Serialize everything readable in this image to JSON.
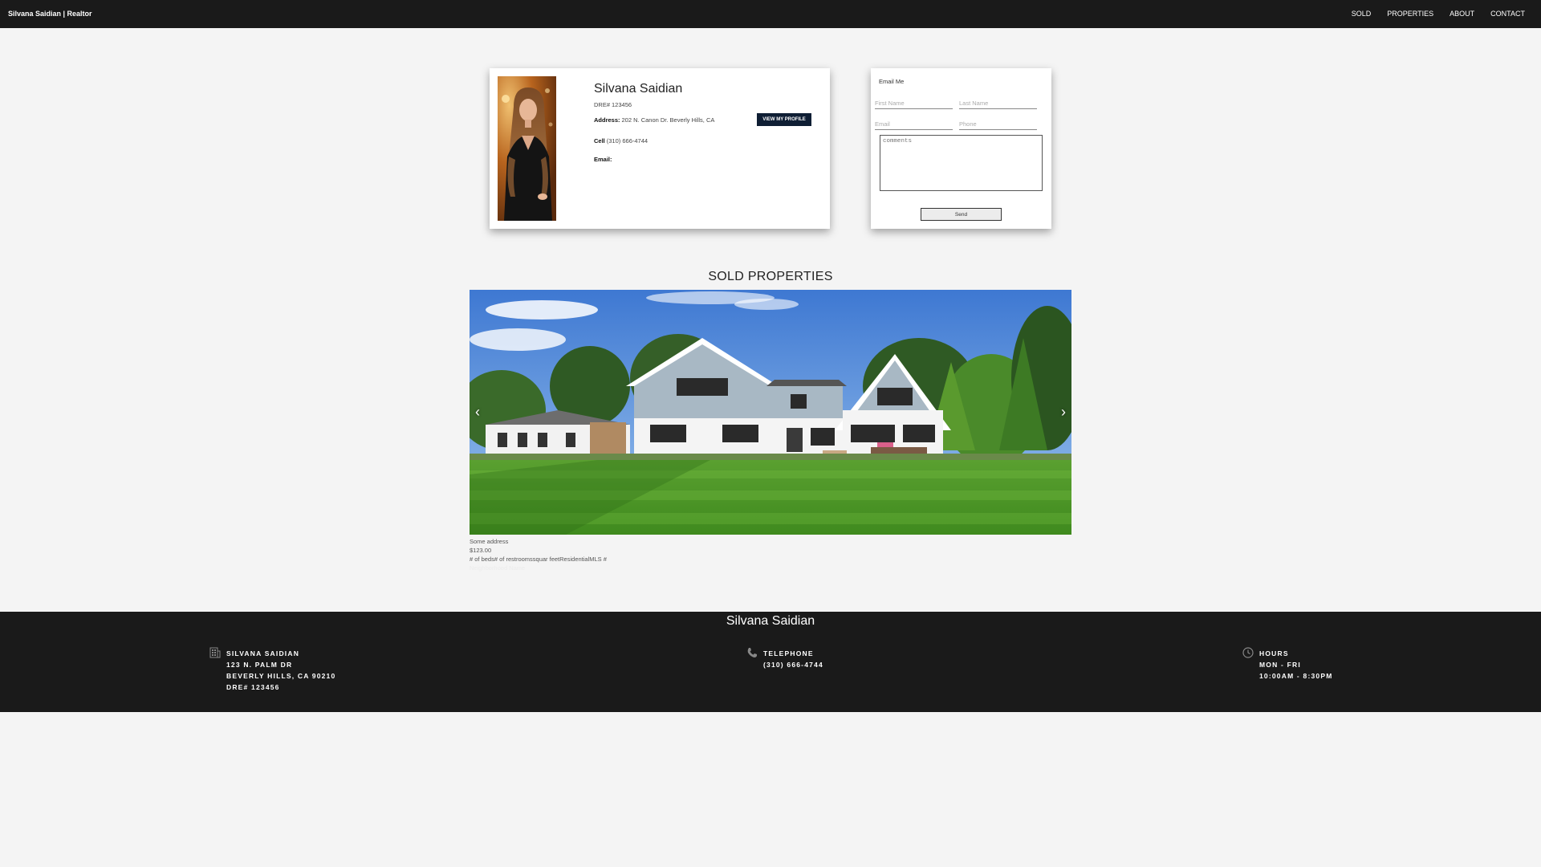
{
  "nav": {
    "brand": "Silvana Saidian | Realtor",
    "links": [
      "SOLD",
      "PROPERTIES",
      "ABOUT",
      "CONTACT"
    ]
  },
  "profile": {
    "name": "Silvana Saidian",
    "dre_label": "DRE#",
    "dre_value": "123456",
    "address_label": "Address:",
    "address_value": "202 N. Canon Dr. Beverly Hills, CA",
    "cell_label": "Cell",
    "cell_value": "(310) 666-4744",
    "email_label": "Email:",
    "email_value": "",
    "view_profile_label": "VIEW MY PROFILE"
  },
  "contact_form": {
    "title": "Email Me",
    "first_name_placeholder": "First Name",
    "last_name_placeholder": "Last Name",
    "email_placeholder": "Email",
    "phone_placeholder": "Phone",
    "comments_placeholder": "comments",
    "send_label": "Send"
  },
  "sold": {
    "title": "SOLD PROPERTIES",
    "property": {
      "address": "Some address",
      "price": "$123.00",
      "details": "# of beds# of restroomssquar feetResidentialMLS #",
      "extra": "Neighborhood Name"
    }
  },
  "footer": {
    "title": "Silvana Saidian",
    "col1_lines": [
      "SILVANA SAIDIAN",
      "123 N. PALM DR",
      "BEVERLY HILLS, CA 90210",
      "DRE# 123456"
    ],
    "col2_lines": [
      "TELEPHONE",
      "(310) 666-4744"
    ],
    "col3_lines": [
      "HOURS",
      "MON - FRI",
      "10:00AM - 8:30PM"
    ]
  },
  "icons": {
    "prev": "chevron-left-icon",
    "next": "chevron-right-icon",
    "building": "building-icon",
    "phone": "phone-icon",
    "clock": "clock-icon"
  },
  "colors": {
    "navbar_bg": "#1a1a1a",
    "button_bg": "#0f1e34",
    "page_bg": "#f4f4f4"
  }
}
